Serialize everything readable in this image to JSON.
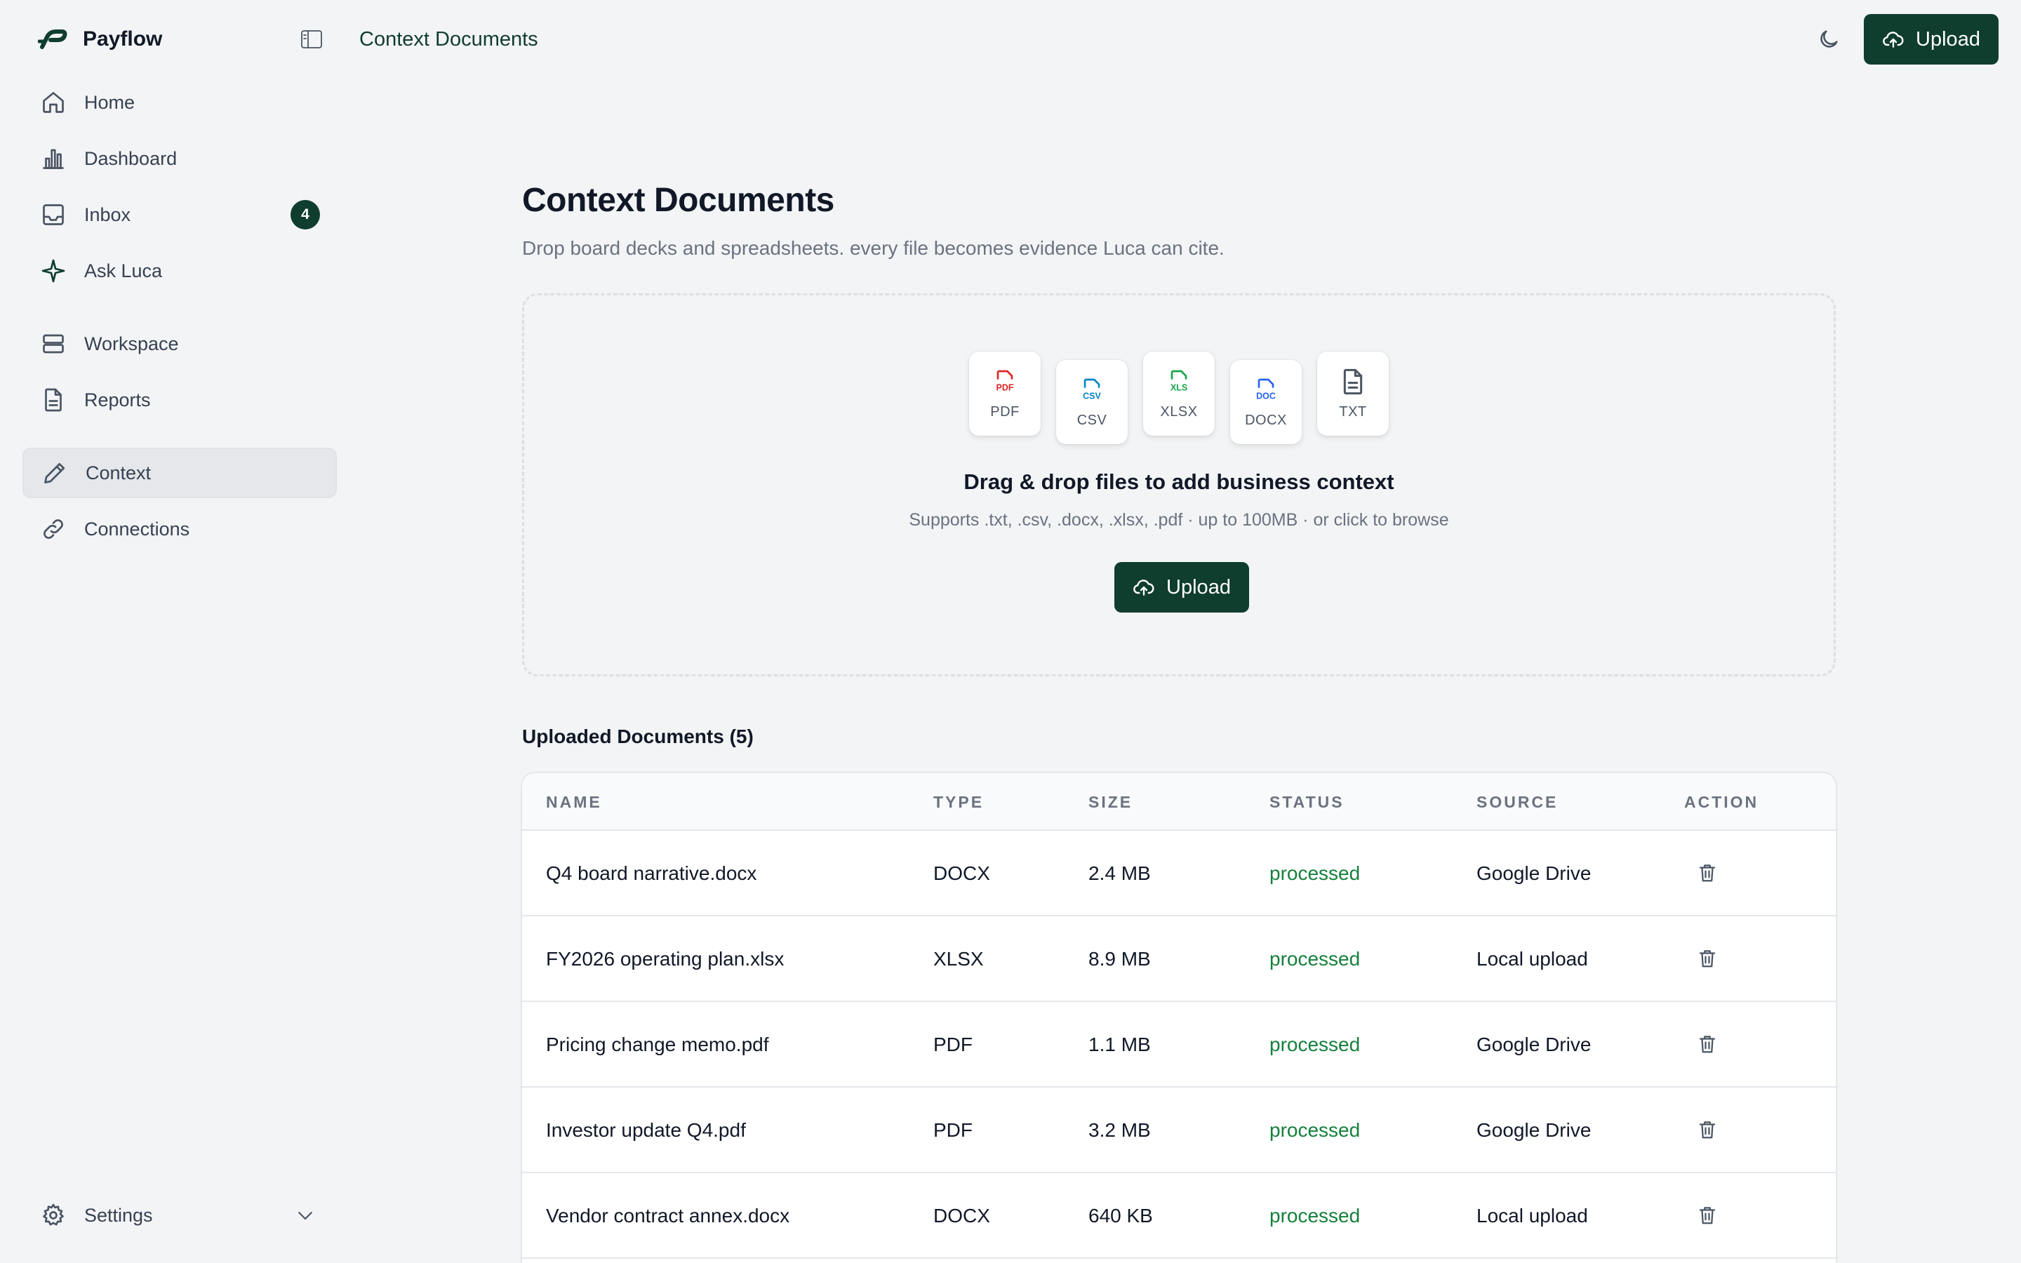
{
  "app": {
    "name": "Payflow"
  },
  "sidebar": {
    "items": [
      {
        "label": "Home",
        "icon": "home-icon"
      },
      {
        "label": "Dashboard",
        "icon": "bar-chart-icon"
      },
      {
        "label": "Inbox",
        "icon": "inbox-icon",
        "badge": "4"
      },
      {
        "label": "Ask Luca",
        "icon": "sparkle-icon"
      },
      {
        "label": "Workspace",
        "icon": "layers-icon"
      },
      {
        "label": "Reports",
        "icon": "document-icon"
      },
      {
        "label": "Context",
        "icon": "pencil-icon",
        "active": true
      },
      {
        "label": "Connections",
        "icon": "link-icon"
      }
    ],
    "settings_label": "Settings"
  },
  "header": {
    "breadcrumb": "Context Documents",
    "upload_label": "Upload"
  },
  "main": {
    "title": "Context Documents",
    "subtitle": "Drop board decks and spreadsheets. every file becomes evidence Luca can cite.",
    "dropzone": {
      "file_types": [
        {
          "tag": "PDF",
          "label": "PDF",
          "color": "#dc2626"
        },
        {
          "tag": "CSV",
          "label": "CSV",
          "color": "#0284c7"
        },
        {
          "tag": "XLS",
          "label": "XLSX",
          "color": "#16a34a"
        },
        {
          "tag": "DOC",
          "label": "DOCX",
          "color": "#2563eb"
        },
        {
          "tag": "",
          "label": "TXT",
          "color": "#4b5563"
        }
      ],
      "title": "Drag & drop files to add business context",
      "subtitle": "Supports .txt, .csv, .docx, .xlsx, .pdf · up to 100MB · or click to browse",
      "upload_label": "Upload"
    },
    "table": {
      "title": "Uploaded Documents (5)",
      "columns": [
        "NAME",
        "TYPE",
        "SIZE",
        "STATUS",
        "SOURCE",
        "ACTION"
      ],
      "rows": [
        {
          "name": "Q4 board narrative.docx",
          "type": "DOCX",
          "size": "2.4 MB",
          "status": "processed",
          "source": "Google Drive"
        },
        {
          "name": "FY2026 operating plan.xlsx",
          "type": "XLSX",
          "size": "8.9 MB",
          "status": "processed",
          "source": "Local upload"
        },
        {
          "name": "Pricing change memo.pdf",
          "type": "PDF",
          "size": "1.1 MB",
          "status": "processed",
          "source": "Google Drive"
        },
        {
          "name": "Investor update Q4.pdf",
          "type": "PDF",
          "size": "3.2 MB",
          "status": "processed",
          "source": "Google Drive"
        },
        {
          "name": "Vendor contract annex.docx",
          "type": "DOCX",
          "size": "640 KB",
          "status": "processed",
          "source": "Local upload"
        }
      ]
    }
  },
  "colors": {
    "brand": "#0f3d2e",
    "status_processed": "#15803d",
    "background": "#f3f4f6"
  }
}
